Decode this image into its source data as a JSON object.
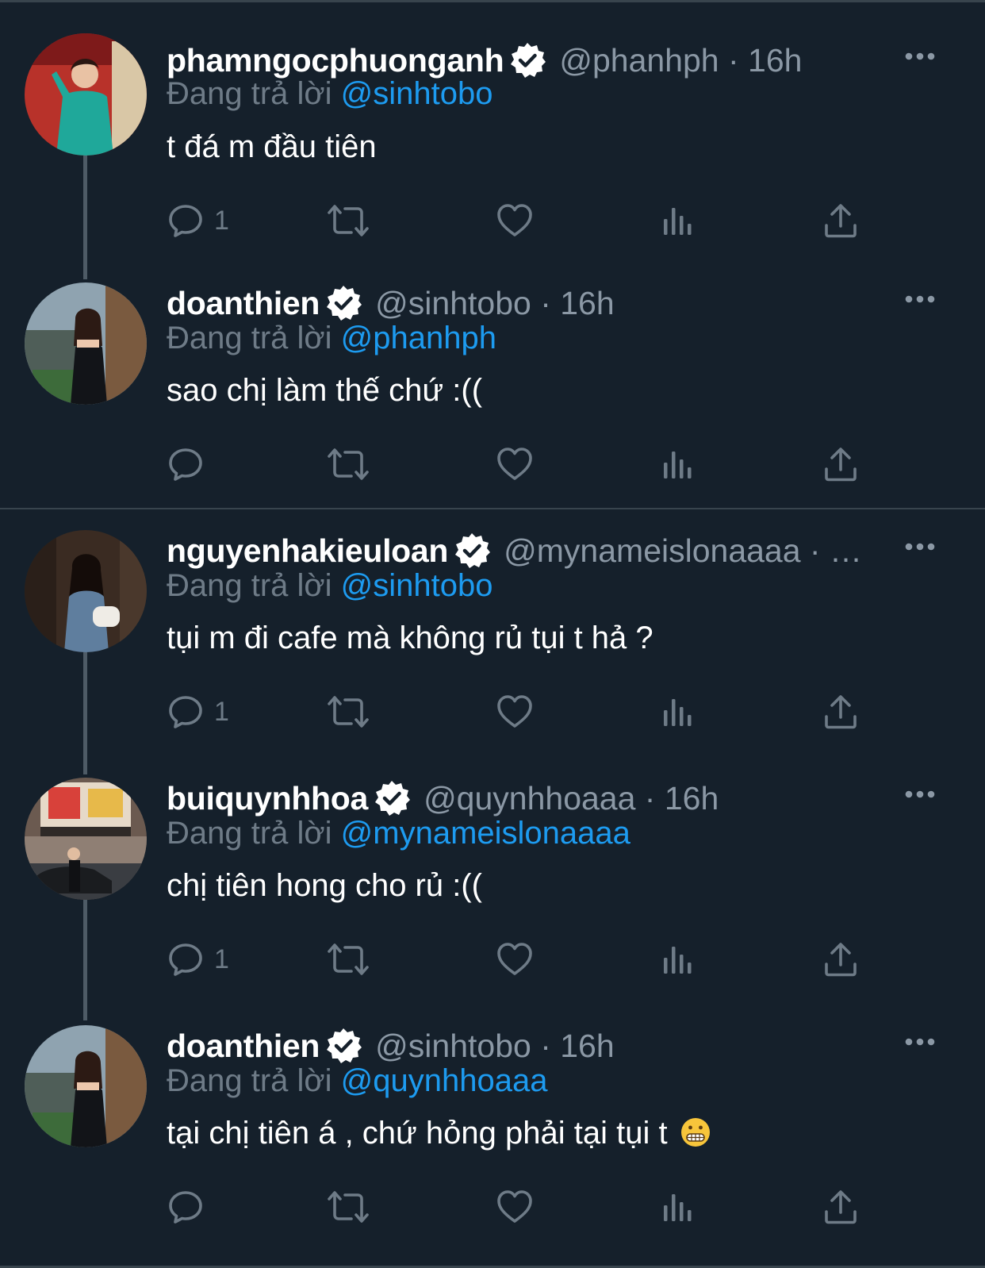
{
  "tweets": [
    {
      "display_name": "phamngocphuonganh",
      "meta": "@phanhph · 16h",
      "reply_prefix": "Đang trả lời",
      "reply_to": "@sinhtobo",
      "text": "t đá m đầu tiên",
      "emoji": "",
      "reply_count": "1",
      "verified": true
    },
    {
      "display_name": "doanthien",
      "meta": "@sinhtobo · 16h",
      "reply_prefix": "Đang trả lời",
      "reply_to": "@phanhph",
      "text": "sao chị làm thế chứ :((",
      "emoji": "",
      "reply_count": "",
      "verified": true
    },
    {
      "display_name": "nguyenhakieuloan",
      "meta": "@mynameislonaaaa · …",
      "reply_prefix": "Đang trả lời",
      "reply_to": "@sinhtobo",
      "text": "tụi m đi cafe mà không rủ tụi t hả ?",
      "emoji": "",
      "reply_count": "1",
      "verified": true
    },
    {
      "display_name": "buiquynhhoa",
      "meta": "@quynhhoaaa · 16h",
      "reply_prefix": "Đang trả lời",
      "reply_to": "@mynameislonaaaa",
      "text": "chị tiên hong cho rủ :((",
      "emoji": "",
      "reply_count": "1",
      "verified": true
    },
    {
      "display_name": "doanthien",
      "meta": "@sinhtobo · 16h",
      "reply_prefix": "Đang trả lời",
      "reply_to": "@quynhhoaaa",
      "text": "tại chị tiên á , chứ hỏng phải tại tụi t",
      "emoji": "grimacing-face-emoji",
      "reply_count": "",
      "verified": true
    }
  ],
  "icons": {
    "reply": "speech-bubble-icon",
    "retweet": "retweet-arrows-icon",
    "like": "heart-icon",
    "views": "bar-chart-icon",
    "share": "share-upload-icon",
    "more": "more-dots-icon",
    "verified": "verified-badge-icon"
  },
  "colors": {
    "background": "#15202b",
    "text": "#ffffff",
    "secondary_text": "#8b98a5",
    "action_icon": "#6e7b87",
    "link": "#1d9bf0",
    "divider": "#38444d",
    "thread_line": "#4e5b66"
  }
}
